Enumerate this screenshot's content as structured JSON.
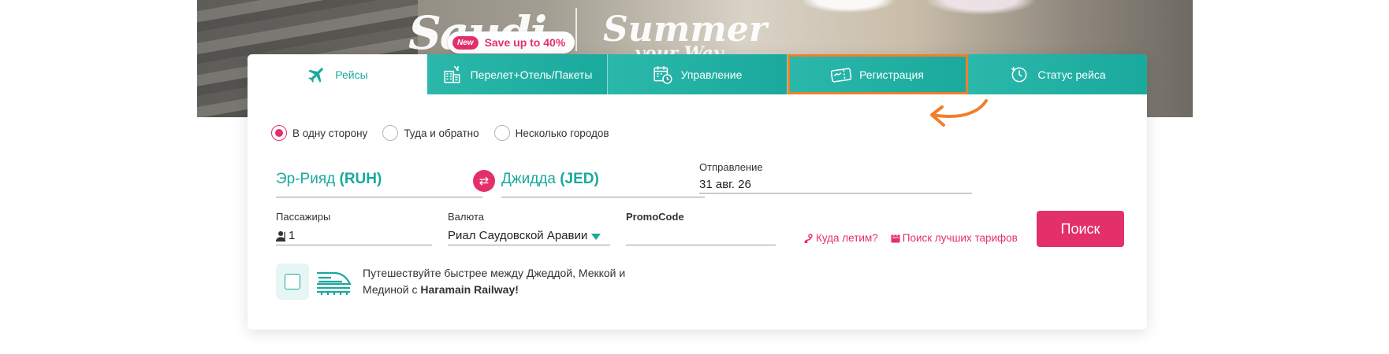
{
  "hero": {
    "promo_badge": "New",
    "promo_text": "Save up to 40%",
    "colors": {
      "teal": "#1aa99d",
      "pink": "#e4306a",
      "highlight": "#f07f2c"
    }
  },
  "tabs": [
    {
      "label": "Рейсы",
      "icon": "airplane-icon",
      "active": true
    },
    {
      "label": "Перелет+Отель/Пакеты",
      "icon": "hotel-building-icon",
      "active": false
    },
    {
      "label": "Управление",
      "icon": "calendar-clock-icon",
      "active": false
    },
    {
      "label": "Регистрация",
      "icon": "boarding-pass-icon",
      "active": false,
      "highlighted": true
    },
    {
      "label": "Статус рейса",
      "icon": "flight-status-clock-icon",
      "active": false
    }
  ],
  "trip_type": {
    "options": [
      "В одну сторону",
      "Туда и обратно",
      "Несколько городов"
    ],
    "selected": "В одну сторону"
  },
  "route": {
    "from_city": "Эр-Рияд",
    "from_code": "(RUH)",
    "to_city": "Джидда",
    "to_code": "(JED)"
  },
  "departure": {
    "label": "Отправление",
    "value": "31 авг. 26"
  },
  "passengers": {
    "label": "Пассажиры",
    "value": "1"
  },
  "currency": {
    "label": "Валюта",
    "value": "Риал Саудовской Аравии"
  },
  "promocode": {
    "label": "PromoCode",
    "value": ""
  },
  "links": {
    "where_to": "Куда летим?",
    "best_fares": "Поиск лучших тарифов"
  },
  "search_button": "Поиск",
  "railway": {
    "line1": "Путешествуйте быстрее между Джеддой, Меккой и",
    "line2_prefix": "Мединой с ",
    "line2_bold": "Haramain Railway!"
  }
}
